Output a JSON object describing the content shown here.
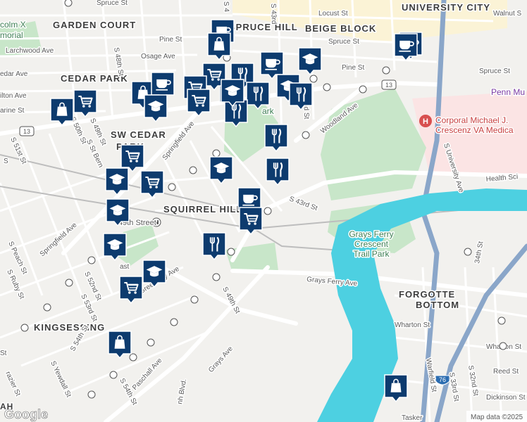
{
  "places": {
    "garden_court": "GARDEN COURT",
    "spruce_hill": "SPRUCE HILL",
    "beige_block": "BEIGE BLOCK",
    "university_city": "UNIVERSITY CITY",
    "cedar_park": "CEDAR PARK",
    "sw_cedar": "SW CEDAR",
    "park": "PARK",
    "squirrel_hill": "SQUIRREL HILL",
    "kingsessing": "KINGSESSING",
    "forgotten": "FORGOTTE",
    "bottom": "BOTTOM",
    "malcolm_x_1": "colm X",
    "malcolm_x_2": "morial",
    "woodland_frag": "ark",
    "ah_frag": "AH"
  },
  "pois": {
    "hospital": "Corporal Michael J. Crescenz VA Medical",
    "hospital_line1": "Corporal Michael J.",
    "hospital_line2": "Crescenz VA Medica",
    "grays_ferry_park_1": "Grays Ferry",
    "grays_ferry_park_2": "Crescent",
    "grays_ferry_park_3": "Trail Park",
    "penn": "Penn Mu",
    "station": "49th Street"
  },
  "streets": {
    "spruce_st_top": "Spruce St",
    "locust_st": "Locust St",
    "walnut_st": "Walnut S",
    "pine_st_w": "Pine St",
    "pine_st_e": "Pine St",
    "spruce_st_mid": "Spruce St",
    "spruce_st_e": "Spruce St",
    "larchwood": "Larchwood Ave",
    "osage": "Osage Ave",
    "cedar_ave": "edar Ave",
    "baltimore": "ilton Ave",
    "catharine": "arine St",
    "s48th": "S 48th St",
    "s49th_n": "S 49th St",
    "s50th": "S 50th St",
    "s51st": "S 51st St",
    "s_st_bern": "S St Bern",
    "springfield_n": "Springfield Ave",
    "springfield_w": "Springfield Ave",
    "woodland": "Woodland Ave",
    "s42nd": "42nd St",
    "s43rd": "S 43rd St",
    "s43rd_n": "S 43rd",
    "s4_n": "S 4",
    "s_university": "S University Ave",
    "health_sci": "Health Sci",
    "grays_ferry_ave": "Grays Ferry Ave",
    "s49th_s": "S 49th St",
    "grays_ave": "Grays Ave",
    "s_peach": "S Peach St",
    "s_ruby": "S Ruby St",
    "s52nd": "S 52nd St",
    "s53rd": "S 53rd St",
    "s54th_w": "S 54th St",
    "s54th": "S 54th St",
    "greenway": "Greenway Ave",
    "paschall": "Paschall Ave",
    "s_yewdall": "S Yewdall St",
    "razier": "razier St",
    "s_st": "S",
    "st_frag": "St",
    "ast": "ast",
    "wharton_st_e": "Wharton St",
    "wharton_st_w": "Wharton St",
    "reed_st": "Reed St",
    "dickinson_st": "Dickinson St",
    "tasker": "Tasker",
    "warfield": "Warfield St",
    "s33rd": "S 33rd St",
    "s32nd": "S 32nd St",
    "s34th": "34th St",
    "mh_blvd": "nh Blvd.",
    "s_prefix": "S"
  },
  "route_shields": [
    "13",
    "13",
    "76"
  ],
  "markers": [
    {
      "type": "coffee-icon"
    },
    {
      "type": "shopping-bag-icon"
    },
    {
      "type": "coffee-icon"
    },
    {
      "type": "graduation-cap-icon"
    },
    {
      "type": "coffee-icon"
    },
    {
      "type": "restaurant-icon"
    },
    {
      "type": "graduation-cap-icon"
    },
    {
      "type": "shopping-cart-icon"
    },
    {
      "type": "shopping-bag-icon"
    },
    {
      "type": "shopping-cart-icon"
    },
    {
      "type": "coffee-icon"
    },
    {
      "type": "restaurant-icon"
    },
    {
      "type": "shopping-bag-icon"
    },
    {
      "type": "shopping-cart-icon"
    },
    {
      "type": "graduation-cap-icon"
    },
    {
      "type": "shopping-cart-icon"
    },
    {
      "type": "graduation-cap-icon"
    },
    {
      "type": "restaurant-icon"
    },
    {
      "type": "restaurant-icon"
    },
    {
      "type": "graduation-cap-icon"
    },
    {
      "type": "restaurant-icon"
    },
    {
      "type": "restaurant-icon"
    },
    {
      "type": "graduation-cap-icon"
    },
    {
      "type": "shopping-cart-icon"
    },
    {
      "type": "graduation-cap-icon"
    },
    {
      "type": "shopping-cart-icon"
    },
    {
      "type": "coffee-icon"
    },
    {
      "type": "shopping-cart-icon"
    },
    {
      "type": "graduation-cap-icon"
    },
    {
      "type": "graduation-cap-icon"
    },
    {
      "type": "restaurant-icon"
    },
    {
      "type": "graduation-cap-icon"
    },
    {
      "type": "shopping-cart-icon"
    },
    {
      "type": "shopping-bag-icon"
    },
    {
      "type": "shopping-bag-icon"
    },
    {
      "type": "coffee-icon"
    }
  ],
  "colors": {
    "land": "#f2f1ee",
    "water": "#4dd0e1",
    "park": "#c8e6c9",
    "road": "#ffffff",
    "campus": "#fbf3d6",
    "highway": "#8aa6c9",
    "marker": "#0d3b6e",
    "hospital_zone": "#fbe4e4"
  },
  "attribution": {
    "google": "Google",
    "map_data": "Map data ©2025"
  }
}
